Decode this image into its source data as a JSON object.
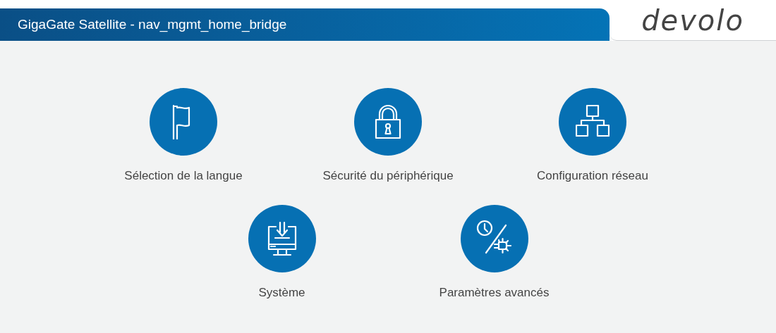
{
  "header": {
    "title": "GigaGate Satellite - nav_mgmt_home_bridge",
    "logo": "devolo"
  },
  "rows": [
    {
      "tiles": [
        {
          "kind": "flag",
          "label": "Sélection de la langue"
        },
        {
          "kind": "lock",
          "label": "Sécurité du périphérique"
        },
        {
          "kind": "network",
          "label": "Configuration réseau"
        }
      ]
    },
    {
      "tiles": [
        {
          "kind": "system",
          "label": "Système"
        },
        {
          "kind": "advanced",
          "label": "Paramètres avancés"
        }
      ]
    }
  ]
}
